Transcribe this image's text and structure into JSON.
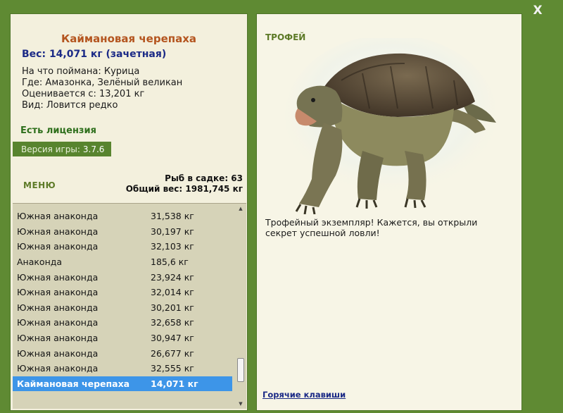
{
  "window": {
    "close_label": "X"
  },
  "fish": {
    "name": "Каймановая черепаха",
    "weight": "Вес: 14,071 кг (зачетная)",
    "bait": "На что поймана: Курица",
    "location": "Где: Амазонка, Зелёный великан",
    "min_weight": "Оценивается с: 13,201 кг",
    "rarity": "Вид: Ловится редко"
  },
  "license": "Есть лицензия",
  "version": {
    "label": "Версия игры:",
    "value": "3.7.6"
  },
  "menu_label": "МЕНЮ",
  "keep": {
    "count": "Рыб в садке: 63",
    "total": "Общий вес: 1981,745 кг"
  },
  "catch_list": [
    {
      "name": "Южная анаконда",
      "weight": "31,538 кг"
    },
    {
      "name": "Южная анаконда",
      "weight": "30,197 кг"
    },
    {
      "name": "Южная анаконда",
      "weight": "32,103 кг"
    },
    {
      "name": "Анаконда",
      "weight": "185,6 кг"
    },
    {
      "name": "Южная анаконда",
      "weight": "23,924 кг"
    },
    {
      "name": "Южная анаконда",
      "weight": "32,014 кг"
    },
    {
      "name": "Южная анаконда",
      "weight": "30,201 кг"
    },
    {
      "name": "Южная анаконда",
      "weight": "32,658 кг"
    },
    {
      "name": "Южная анаконда",
      "weight": "30,947 кг"
    },
    {
      "name": "Южная анаконда",
      "weight": "26,677 кг"
    },
    {
      "name": "Южная анаконда",
      "weight": "32,555 кг"
    },
    {
      "name": "Каймановая черепаха",
      "weight": "14,071 кг",
      "selected": true
    }
  ],
  "trophy": {
    "label": "ТРОФЕЙ",
    "description": "Трофейный экземпляр! Кажется, вы открыли секрет успешной ловли!"
  },
  "hotkeys_label": "Горячие клавиши",
  "colors": {
    "frame": "#5f8a33",
    "panel": "#f3f0dd",
    "title": "#b4551f",
    "weight_text": "#1b2a86",
    "selection": "#3d95e8"
  }
}
